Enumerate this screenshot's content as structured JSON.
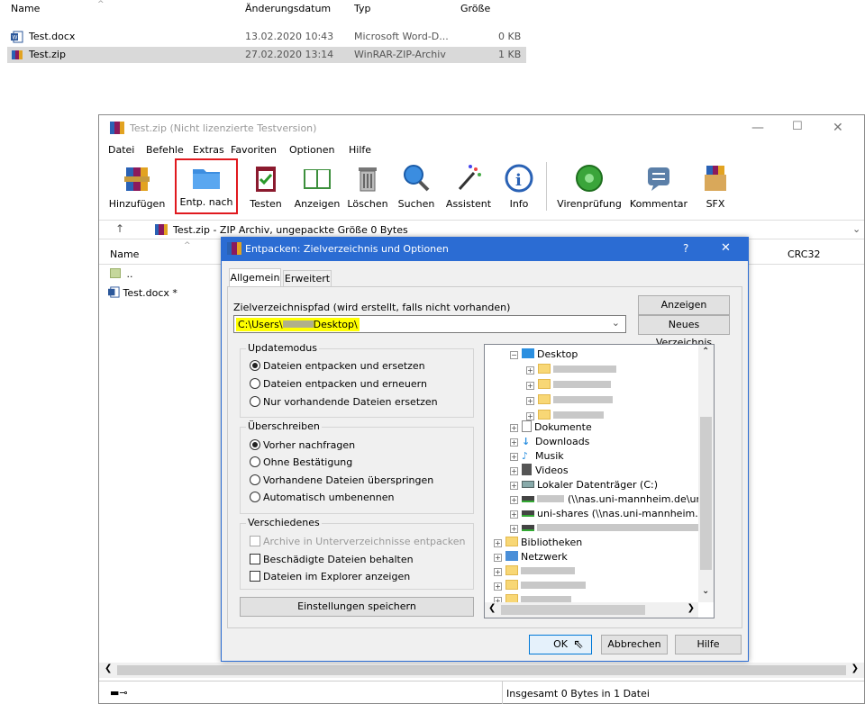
{
  "explorer": {
    "headers": {
      "name": "Name",
      "date": "Änderungsdatum",
      "type": "Typ",
      "size": "Größe"
    },
    "files": [
      {
        "name": "Test.docx",
        "date": "13.02.2020 10:43",
        "type": "Microsoft Word-D...",
        "size": "0 KB"
      },
      {
        "name": "Test.zip",
        "date": "27.02.2020 13:14",
        "type": "WinRAR-ZIP-Archiv",
        "size": "1 KB"
      }
    ]
  },
  "winrar": {
    "title": "Test.zip (Nicht lizenzierte Testversion)",
    "menu": [
      "Datei",
      "Befehle",
      "Extras",
      "Favoriten",
      "Optionen",
      "Hilfe"
    ],
    "toolbar": [
      "Hinzufügen",
      "Entp. nach",
      "Testen",
      "Anzeigen",
      "Löschen",
      "Suchen",
      "Assistent",
      "Info",
      "Virenprüfung",
      "Kommentar",
      "SFX"
    ],
    "address": "Test.zip - ZIP Archiv, ungepackte Größe 0 Bytes",
    "col_name": "Name",
    "col_crc": "CRC32",
    "rows": [
      "..",
      "Test.docx *"
    ],
    "status": "Insgesamt 0 Bytes in 1 Datei"
  },
  "dialog": {
    "title": "Entpacken: Zielverzeichnis und Optionen",
    "help_glyph": "?",
    "close_glyph": "✕",
    "tabs": [
      "Allgemein",
      "Erweitert"
    ],
    "path_label": "Zielverzeichnispfad (wird erstellt, falls nicht vorhanden)",
    "path_value_prefix": "C:\\Users\\",
    "path_value_suffix": "Desktop\\",
    "btn_show": "Anzeigen",
    "btn_new_dir": "Neues Verzeichnis",
    "update_label": "Updatemodus",
    "update_opts": [
      "Dateien entpacken und ersetzen",
      "Dateien entpacken und erneuern",
      "Nur vorhandende Dateien ersetzen"
    ],
    "overwrite_label": "Überschreiben",
    "overwrite_opts": [
      "Vorher nachfragen",
      "Ohne Bestätigung",
      "Vorhandene Dateien überspringen",
      "Automatisch umbenennen"
    ],
    "misc_label": "Verschiedenes",
    "misc_opts": [
      "Archive in Unterverzeichnisse entpacken",
      "Beschädigte Dateien behalten",
      "Dateien im Explorer anzeigen"
    ],
    "save_settings": "Einstellungen speichern",
    "tree": {
      "desktop": "Desktop",
      "documents": "Dokumente",
      "downloads": "Downloads",
      "music": "Musik",
      "videos": "Videos",
      "local": "Lokaler Datenträger (C:)",
      "nas1": "(\\\\nas.uni-mannheim.de\\uni-sha",
      "nas2": "uni-shares (\\\\nas.uni-mannheim.de) (Y:",
      "libraries": "Bibliotheken",
      "network": "Netzwerk"
    },
    "ok": "OK",
    "cancel": "Abbrechen",
    "help": "Hilfe"
  },
  "colors": {
    "highlight": "#ffff00",
    "accent": "#2b6cd3",
    "red_box": "#e0191e"
  }
}
